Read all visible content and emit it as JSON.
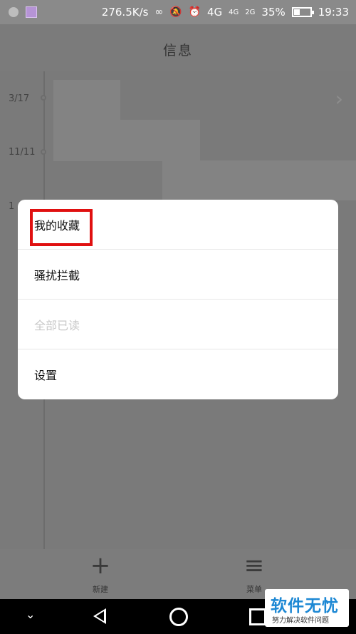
{
  "status": {
    "speed": "276.5K/s",
    "network_1": "4G",
    "network_2": "4G",
    "network_3": "2G",
    "battery": "35%",
    "time": "19:33"
  },
  "header": {
    "title": "信息"
  },
  "timeline": {
    "dates": [
      "3/17",
      "11/11",
      "1"
    ]
  },
  "menu": {
    "items": [
      {
        "label": "我的收藏",
        "enabled": true
      },
      {
        "label": "骚扰拦截",
        "enabled": true
      },
      {
        "label": "全部已读",
        "enabled": false
      },
      {
        "label": "设置",
        "enabled": true
      }
    ]
  },
  "bottom_bar": {
    "new_label": "新建",
    "menu_label": "菜单"
  },
  "watermark": {
    "title": "软件无忧",
    "subtitle": "努力解决软件问题"
  }
}
